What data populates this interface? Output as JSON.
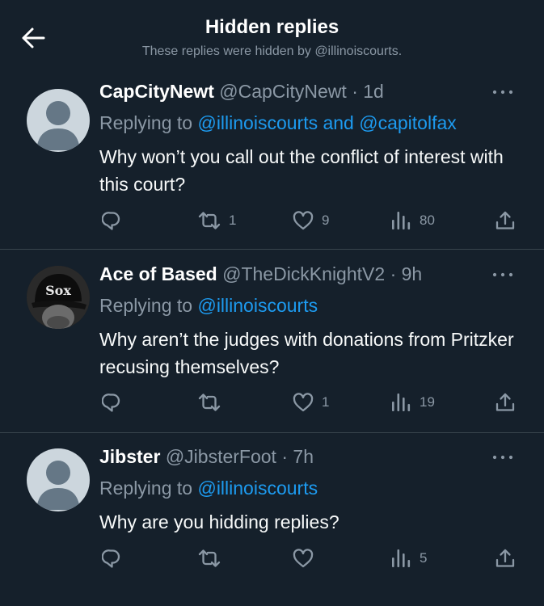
{
  "header": {
    "title": "Hidden replies",
    "subtitle": "These replies were hidden by @illinoiscourts."
  },
  "tweets": [
    {
      "name": "CapCityNewt",
      "handle": "@CapCityNewt",
      "separator": "·",
      "time": "1d",
      "replying_prefix": "Replying to ",
      "replying_to": "@illinoiscourts and @capitolfax",
      "text": "Why won’t you call out the conflict of interest with this court?",
      "avatar": "default-avatar",
      "replies": "",
      "retweets": "1",
      "likes": "9",
      "views": "80"
    },
    {
      "name": "Ace of Based",
      "handle": "@TheDickKnightV2",
      "separator": "·",
      "time": "9h",
      "replying_prefix": "Replying to ",
      "replying_to": "@illinoiscourts",
      "text": "Why aren’t the judges with donations from Pritzker recusing themselves?",
      "avatar": "photo-avatar-sox-cap",
      "replies": "",
      "retweets": "",
      "likes": "1",
      "views": "19"
    },
    {
      "name": "Jibster",
      "handle": "@JibsterFoot",
      "separator": "·",
      "time": "7h",
      "replying_prefix": "Replying to ",
      "replying_to": "@illinoiscourts",
      "text": "Why are you hidding replies?",
      "avatar": "default-avatar",
      "replies": "",
      "retweets": "",
      "likes": "",
      "views": "5"
    }
  ],
  "colors": {
    "background": "#15202b",
    "text": "#f7f9f9",
    "secondary": "#8b98a5",
    "link": "#1d9bf0",
    "divider": "#38444d"
  },
  "icons": [
    "back-arrow-icon",
    "more-icon",
    "reply-icon",
    "retweet-icon",
    "like-icon",
    "views-icon",
    "share-icon"
  ]
}
